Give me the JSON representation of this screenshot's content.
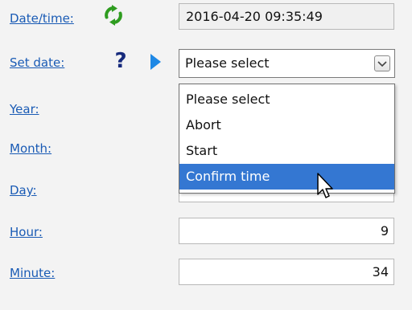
{
  "labels": {
    "datetime": "Date/time:",
    "set_date": "Set date:",
    "year": "Year:",
    "month": "Month:",
    "day": "Day:",
    "hour": "Hour:",
    "minute": "Minute:"
  },
  "fields": {
    "datetime_value": "2016-04-20 09:35:49",
    "hour_value": "9",
    "minute_value": "34"
  },
  "set_date_select": {
    "selected": "Please select",
    "options": [
      "Please select",
      "Abort",
      "Start",
      "Confirm time"
    ],
    "highlighted_option": "Confirm time"
  },
  "icons": {
    "refresh": "refresh-icon",
    "help": "?",
    "arrow": "play-arrow-icon",
    "dropdown": "chevron-down-icon",
    "cursor": "mouse-pointer-icon"
  },
  "colors": {
    "link": "#1a5bb5",
    "refresh_green": "#2e9c1f",
    "help_navy": "#162a7c",
    "arrow_blue": "#1e88e5",
    "selection": "#3477d2"
  }
}
